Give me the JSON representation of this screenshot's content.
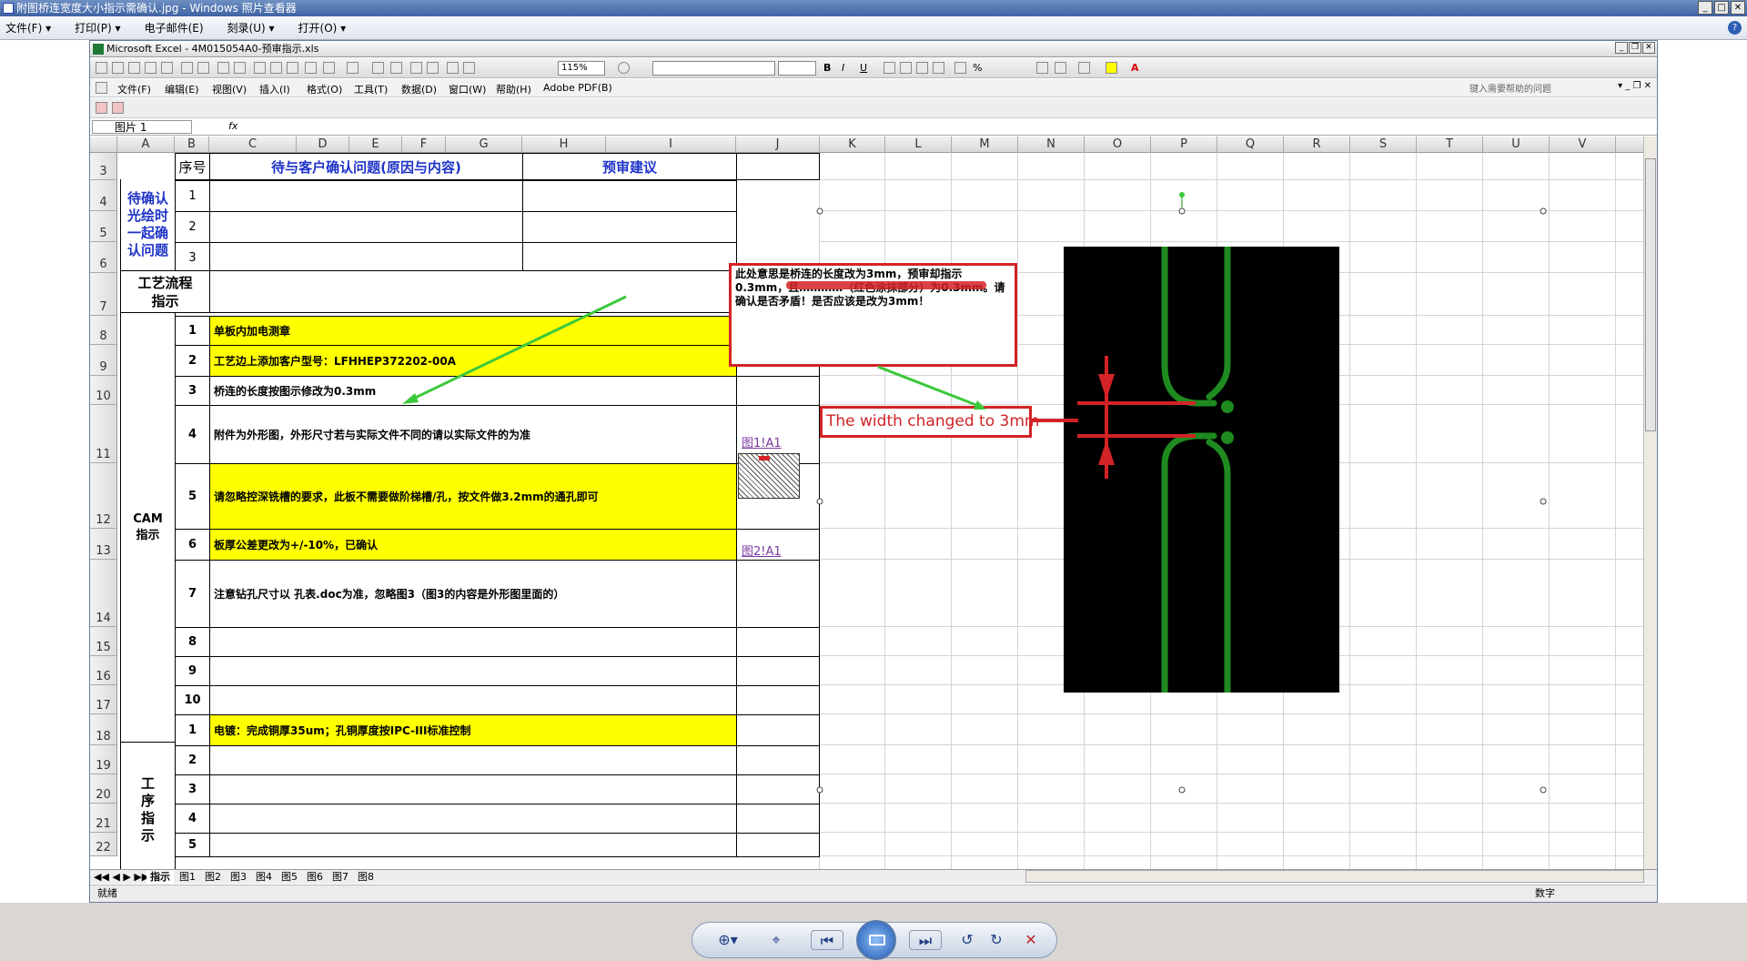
{
  "viewer": {
    "title": "附图桥连宽度大小指示需确认.jpg - Windows 照片查看器",
    "menu": [
      "文件(F) ▾",
      "打印(P) ▾",
      "电子邮件(E)",
      "刻录(U) ▾",
      "打开(O) ▾"
    ],
    "window_buttons": [
      "_",
      "□",
      "✕"
    ],
    "help": "?"
  },
  "excel": {
    "title": "Microsoft Excel - 4M015054A0-预审指示.xls",
    "zoom": "115%",
    "menu": [
      "文件(F)",
      "编辑(E)",
      "视图(V)",
      "插入(I)",
      "格式(O)",
      "工具(T)",
      "数据(D)",
      "窗口(W)",
      "帮助(H)",
      "Adobe PDF(B)"
    ],
    "ask_placeholder": "键入需要帮助的问题",
    "name_box": "图片 1",
    "fx": "fx",
    "columns": [
      "A",
      "B",
      "C",
      "D",
      "E",
      "F",
      "G",
      "H",
      "I",
      "J",
      "K",
      "L",
      "M",
      "N",
      "O",
      "P",
      "Q",
      "R",
      "S",
      "T",
      "U",
      "V"
    ],
    "rows": [
      "3",
      "4",
      "5",
      "6",
      "7",
      "8",
      "9",
      "10",
      "11",
      "12",
      "13",
      "14",
      "15",
      "16",
      "17",
      "18",
      "19",
      "20",
      "21",
      "22"
    ],
    "header": {
      "seq": "序号",
      "question": "待与客户确认问题(原因与内容)",
      "suggest": "预审建议"
    },
    "confirm_group": "待确认光绘时一起确认问题",
    "confirm_nums": [
      "1",
      "2",
      "3"
    ],
    "process_label": "工艺流程指示",
    "cam_label": "CAM指示",
    "cam_items": [
      {
        "num": "1",
        "text": "单板内加电测章"
      },
      {
        "num": "2",
        "text": "工艺边上添加客户型号：LFHHEP372202-00A"
      },
      {
        "num": "3",
        "text": "桥连的长度按图示修改为0.3mm"
      },
      {
        "num": "4",
        "text": "附件为外形图，外形尺寸若与实际文件不同的请以实际文件的为准"
      },
      {
        "num": "5",
        "text": "请忽略控深铣槽的要求，此板不需要做阶梯槽/孔，按文件做3.2mm的通孔即可"
      },
      {
        "num": "6",
        "text": "板厚公差更改为+/-10%，已确认"
      },
      {
        "num": "7",
        "text": "注意钻孔尺寸以 孔表.doc为准，忽略图3（图3的内容是外形图里面的）"
      },
      {
        "num": "8",
        "text": ""
      },
      {
        "num": "9",
        "text": ""
      },
      {
        "num": "10",
        "text": ""
      }
    ],
    "links": [
      "图1!A1",
      "图2!A1"
    ],
    "process_group": "工序指示",
    "process_items": [
      {
        "num": "1",
        "text": "电镀：完成铜厚35um；孔铜厚度按IPC-III标准控制"
      },
      {
        "num": "2",
        "text": ""
      },
      {
        "num": "3",
        "text": ""
      },
      {
        "num": "4",
        "text": ""
      },
      {
        "num": "5",
        "text": ""
      }
    ],
    "sheet_tabs": [
      "指示",
      "图1",
      "图2",
      "图3",
      "图4",
      "图5",
      "图6",
      "图7",
      "图8"
    ],
    "status_left": "就绪",
    "status_right": "数字"
  },
  "annotation": {
    "note_text": "此处意思是桥连的长度改为3mm，预审却指示0.3mm，且…………（红色涂抹部分）为0.3mm。请确认是否矛盾！是否应该是改为3mm！",
    "width_label": "The width changed to 3mm"
  },
  "colors": {
    "highlight": "#ffff00",
    "annotation_red": "#d32326",
    "arrow_green": "#3cc83c",
    "trace_green": "#1f8a1f",
    "header_blue": "#1f34c8"
  }
}
